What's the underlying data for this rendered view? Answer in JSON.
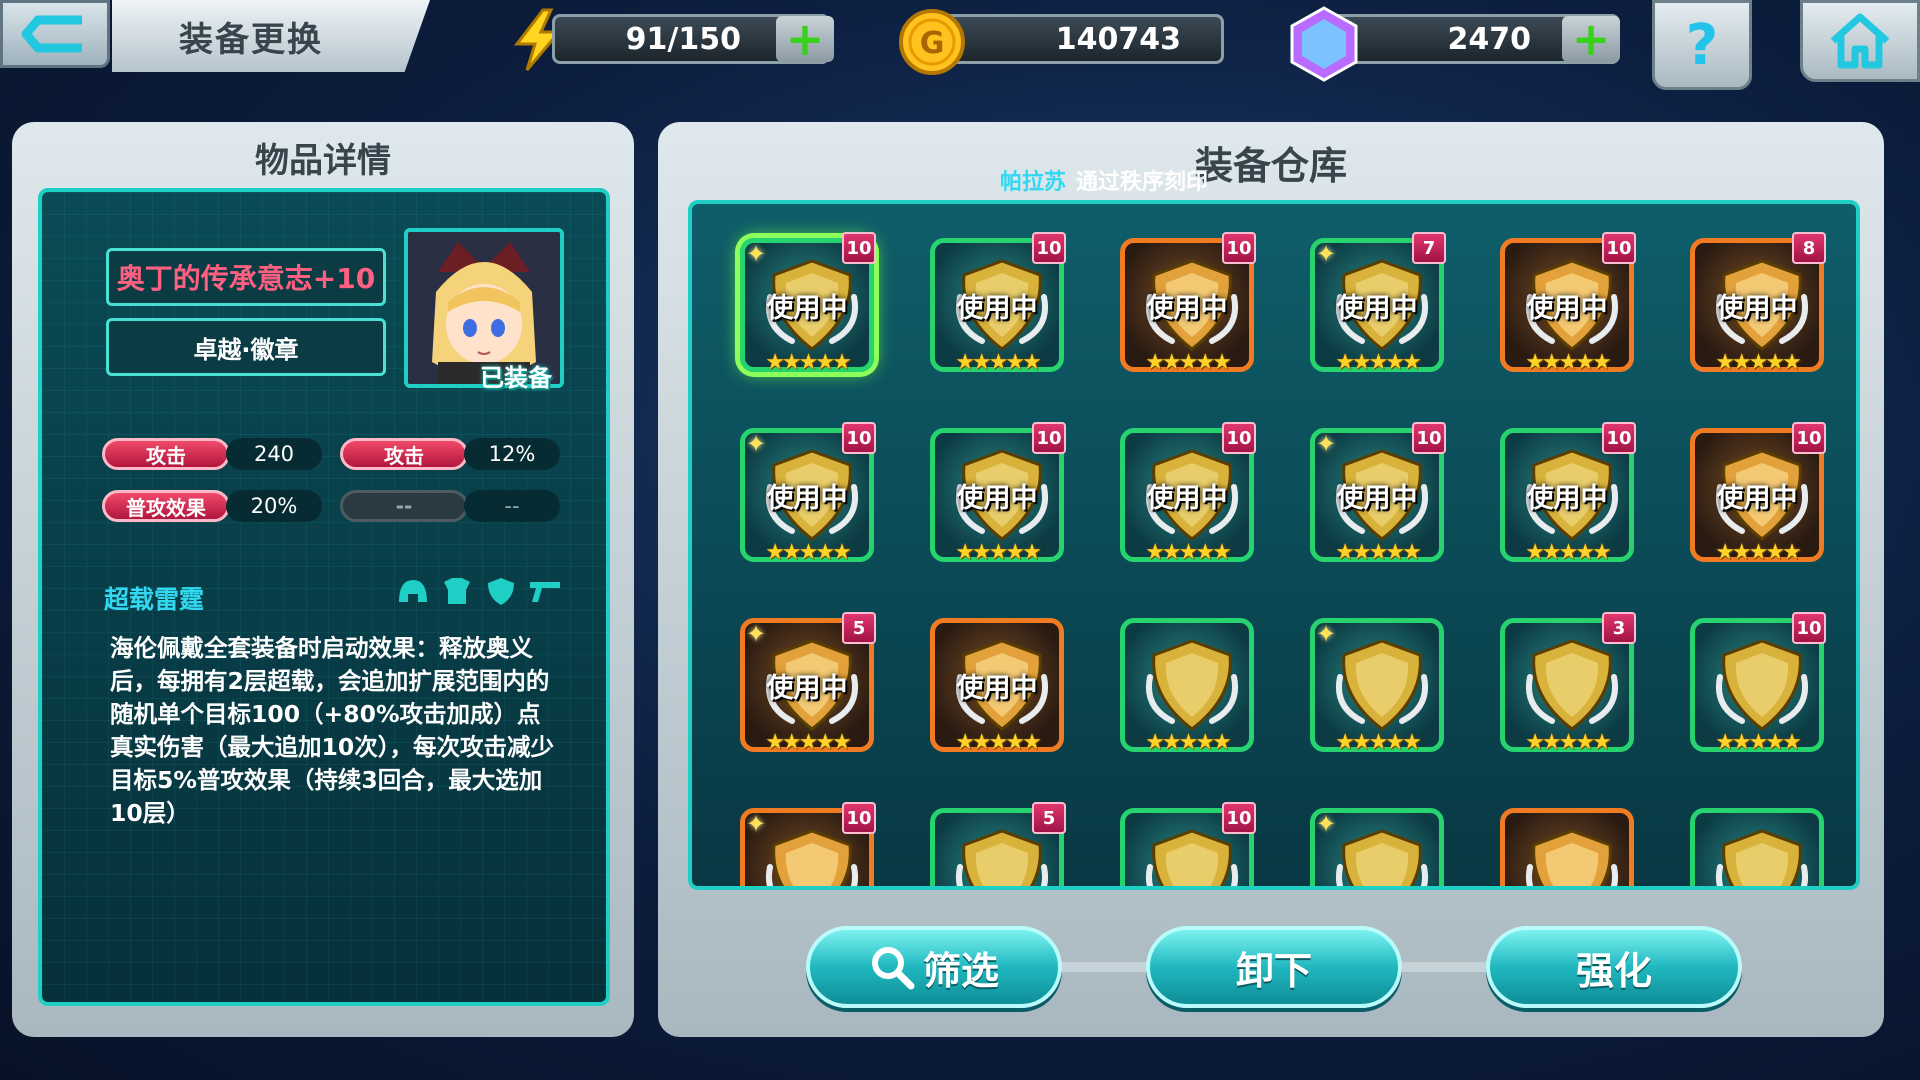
{
  "header": {
    "title": "装备更换",
    "energy": "91/150",
    "gold": "140743",
    "gems": "2470",
    "help_label": "?"
  },
  "detail_panel": {
    "title": "物品详情",
    "item_name": "奥丁的传承意志+10",
    "item_type": "卓越·徽章",
    "equipped_label": "已装备",
    "stats": [
      {
        "name": "攻击",
        "value": "240"
      },
      {
        "name": "攻击",
        "value": "12%"
      },
      {
        "name": "普攻效果",
        "value": "20%"
      },
      {
        "name": "--",
        "value": "--"
      }
    ],
    "set_name": "超载雷霆",
    "set_description": "海伦佩戴全套装备时启动效果：释放奥义后，每拥有2层超载，会追加扩展范围内的随机单个目标100（+80%攻击加成）点真实伤害（最大追加10次），每次攻击减少目标5%普攻效果（持续3回合，最大选加10层）"
  },
  "warehouse": {
    "title": "装备仓库",
    "announce_player": "帕拉苏",
    "announce_text": "通过秩序刻印",
    "in_use_label": "使用中",
    "items": [
      {
        "level": "10",
        "in_use": true,
        "rarity": "green",
        "stars": "★★★★★",
        "icon": "claw-emblem"
      },
      {
        "level": "10",
        "in_use": true,
        "rarity": "green",
        "stars": "★★★★★",
        "icon": "ring-emblem"
      },
      {
        "level": "10",
        "in_use": true,
        "rarity": "orange",
        "stars": "★★★★★",
        "icon": "horn-emblem"
      },
      {
        "level": "7",
        "in_use": true,
        "rarity": "green",
        "stars": "★★★★★",
        "icon": "octopus-emblem"
      },
      {
        "level": "10",
        "in_use": true,
        "rarity": "orange",
        "stars": "★★★★★",
        "icon": "wing-emblem"
      },
      {
        "level": "8",
        "in_use": true,
        "rarity": "orange",
        "stars": "★★★★★",
        "icon": "crest-emblem"
      },
      {
        "level": "10",
        "in_use": true,
        "rarity": "green",
        "stars": "★★★★★",
        "icon": "claw-emblem"
      },
      {
        "level": "10",
        "in_use": true,
        "rarity": "green",
        "stars": "★★★★★",
        "icon": "crossed-blades-emblem"
      },
      {
        "level": "10",
        "in_use": true,
        "rarity": "green",
        "stars": "★★★★★",
        "icon": "dragon-emblem"
      },
      {
        "level": "10",
        "in_use": true,
        "rarity": "green",
        "stars": "★★★★★",
        "icon": "shield-emblem"
      },
      {
        "level": "10",
        "in_use": true,
        "rarity": "green",
        "stars": "★★★★★",
        "icon": "gem-emblem"
      },
      {
        "level": "10",
        "in_use": true,
        "rarity": "orange",
        "stars": "★★★★★",
        "icon": "lightning-emblem"
      },
      {
        "level": "5",
        "in_use": true,
        "rarity": "orange",
        "stars": "★★★★★",
        "icon": "wing-badge"
      },
      {
        "level": "",
        "in_use": true,
        "rarity": "orange",
        "stars": "★★★★★",
        "icon": "wing-badge"
      },
      {
        "level": "",
        "in_use": false,
        "rarity": "green",
        "stars": "★★★★★",
        "icon": "dice-emblem"
      },
      {
        "level": "",
        "in_use": false,
        "rarity": "green",
        "stars": "★★★★★",
        "icon": "dice-emblem"
      },
      {
        "level": "3",
        "in_use": false,
        "rarity": "green",
        "stars": "★★★★★",
        "icon": "sword-emblem"
      },
      {
        "level": "10",
        "in_use": false,
        "rarity": "green",
        "stars": "★★★★★",
        "icon": "eye-emblem"
      },
      {
        "level": "10",
        "in_use": false,
        "rarity": "orange",
        "stars": "",
        "icon": "purple-emblem"
      },
      {
        "level": "5",
        "in_use": false,
        "rarity": "green",
        "stars": "",
        "icon": "blade-emblem"
      },
      {
        "level": "10",
        "in_use": false,
        "rarity": "green",
        "stars": "",
        "icon": "bunny-emblem"
      },
      {
        "level": "",
        "in_use": false,
        "rarity": "green",
        "stars": "",
        "icon": "orange-emblem"
      },
      {
        "level": "",
        "in_use": false,
        "rarity": "orange",
        "stars": "",
        "icon": "red-emblem"
      },
      {
        "level": "",
        "in_use": false,
        "rarity": "green",
        "stars": "",
        "icon": "spiral-emblem"
      }
    ]
  },
  "buttons": {
    "filter": "筛选",
    "unequip": "卸下",
    "enhance": "强化"
  },
  "colors": {
    "accent_cyan": "#1fcfc5",
    "badge_red": "#e0366e",
    "rarity_green": "#26d36e",
    "rarity_orange": "#f07b22",
    "item_name_pink": "#ff5f80"
  }
}
